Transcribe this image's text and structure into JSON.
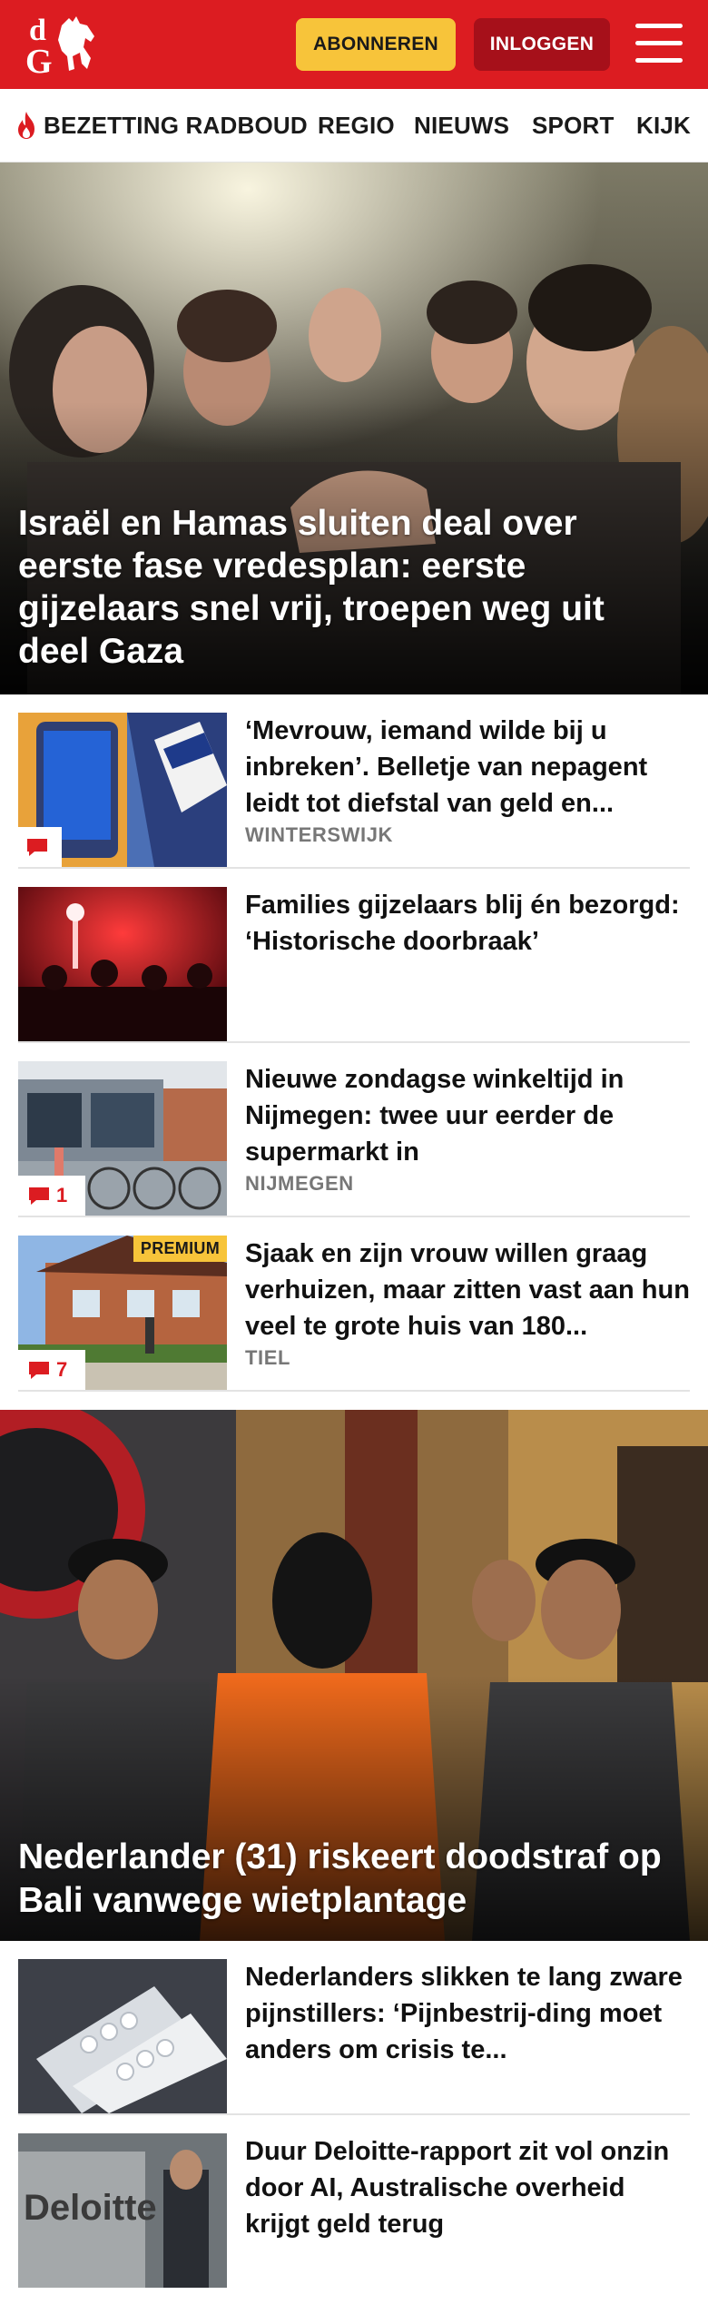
{
  "header": {
    "logo_text": "dG",
    "subscribe_label": "ABONNEREN",
    "login_label": "INLOGGEN",
    "menu_icon": "hamburger-menu-icon",
    "brand_color": "#dc1c21"
  },
  "nav": {
    "items": [
      {
        "label": "BEZETTING RADBOUD",
        "icon": "flame-icon"
      },
      {
        "label": "REGIO"
      },
      {
        "label": "NIEUWS"
      },
      {
        "label": "SPORT"
      },
      {
        "label": "KIJK"
      }
    ]
  },
  "hero": {
    "title": "Israël en Hamas sluiten deal over eerste fase vredesplan: eerste gijzelaars snel vrij, troepen weg uit deel Gaza"
  },
  "articles": [
    {
      "title": "‘Mevrouw, iemand wilde bij u inbreken’. Belletje van nepagent leidt tot diefstal van geld en...",
      "location": "WINTERSWIJK",
      "comments": ""
    },
    {
      "title": "Families gijzelaars blij én bezorgd: ‘Historische doorbraak’",
      "location": "",
      "comments": ""
    },
    {
      "title": "Nieuwe zondagse winkeltijd in Nijmegen: twee uur eerder de supermarkt in",
      "location": "NIJMEGEN",
      "comments": "1"
    },
    {
      "title": "Sjaak en zijn vrouw willen graag verhuizen, maar zitten vast aan hun veel te grote huis van 180...",
      "location": "TIEL",
      "comments": "7",
      "badge": "PREMIUM"
    }
  ],
  "feature": {
    "title": "Nederlander (31) riskeert doodstraf op Bali vanwege wietplantage"
  },
  "articles2": [
    {
      "title": "Nederlanders slikken te lang zware pijnstillers: ‘Pijnbestrij-ding moet anders om crisis te..."
    },
    {
      "title": "Duur Deloitte-rapport zit vol onzin door AI, Australische overheid krijgt geld terug"
    }
  ]
}
